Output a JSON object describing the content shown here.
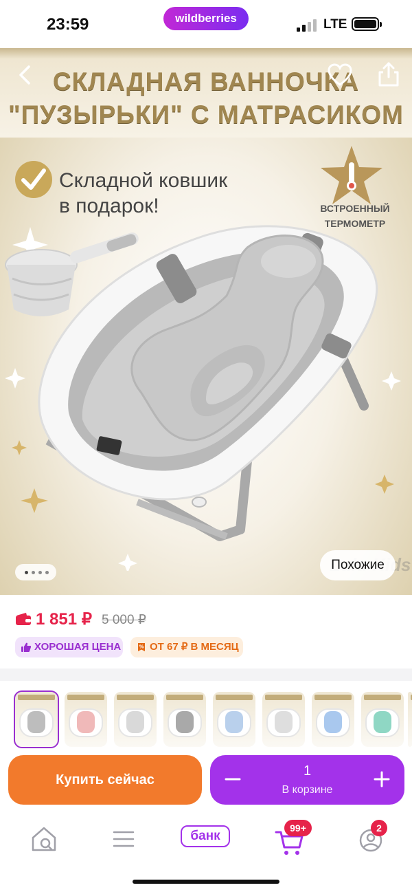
{
  "status_bar": {
    "time": "23:59",
    "app_name": "wildberries",
    "network": "LTE"
  },
  "hero": {
    "title_line1": "СКЛАДНАЯ ВАННОЧКА",
    "title_line2": "\"ПУЗЫРЬКИ\" С МАТРАСИКОМ",
    "promo_line1": "Складной ковшик",
    "promo_line2": "в подарок!",
    "badge_line1": "ВСТРОЕННЫЙ",
    "badge_line2": "ТЕРМОМЕТР",
    "brand_watermark": "Lulu Kids",
    "similar_label": "Похожие",
    "gallery_dots": {
      "count": 4,
      "active_index": 0
    }
  },
  "product": {
    "price": "1 851 ₽",
    "old_price": "5 000 ₽",
    "badges": [
      {
        "label": "ХОРОШАЯ ЦЕНА",
        "icon": "thumbs-up-icon"
      },
      {
        "label": "ОТ 67 ₽ В МЕСЯЦ",
        "icon": "installment-icon"
      }
    ]
  },
  "variants": {
    "count_visible": 9,
    "selected_index": 0,
    "mat_colors": [
      "#bdbdbd",
      "#f0b9b9",
      "#d9d9d9",
      "#a9a9a9",
      "#b9d0ec",
      "#dedede",
      "#a9c8ee",
      "#8fd7c4",
      "#cfcfcf"
    ]
  },
  "actions": {
    "buy_now": "Купить сейчас",
    "cart_quantity": "1",
    "cart_label": "В корзине"
  },
  "tabbar": {
    "bank_label": "банк",
    "cart_badge": "99+",
    "profile_badge": "2"
  },
  "colors": {
    "accent_purple": "#a332ea",
    "buy_orange": "#f27a2c",
    "price_red": "#e6234a"
  }
}
